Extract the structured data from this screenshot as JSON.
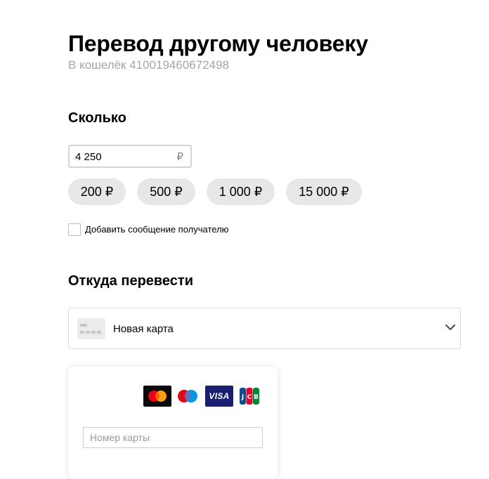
{
  "header": {
    "title": "Перевод другому человеку",
    "subtitle": "В кошелёк 410019460672498"
  },
  "amount": {
    "heading": "Сколько",
    "value": "4 250",
    "currency": "₽",
    "presets": [
      "200 ₽",
      "500 ₽",
      "1 000 ₽",
      "15 000 ₽"
    ],
    "message_checkbox_label": "Добавить сообщение получателю",
    "message_checked": false
  },
  "source": {
    "heading": "Откуда перевести",
    "selected_label": "Новая карта",
    "selected_icon": "card-icon",
    "chevron_icon": "chevron-down-icon"
  },
  "card_form": {
    "logos": [
      "mastercard-logo",
      "maestro-logo",
      "visa-logo",
      "jcb-logo"
    ],
    "visa_text": "VISA",
    "card_number_placeholder": "Номер карты"
  }
}
